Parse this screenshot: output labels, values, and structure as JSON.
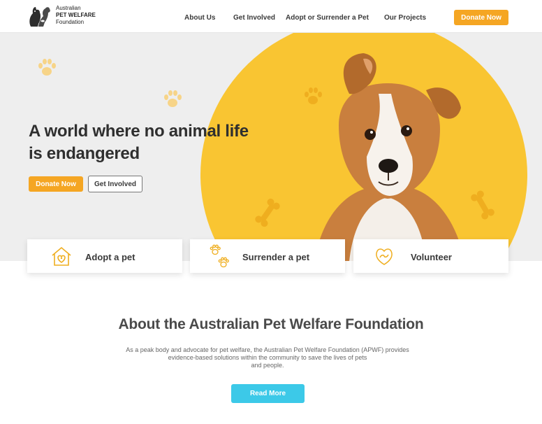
{
  "logo": {
    "line1": "Australian",
    "line2": "PET WELFARE",
    "line3": "Foundation"
  },
  "nav": {
    "items": [
      {
        "label": "About Us"
      },
      {
        "label": "Get Involved"
      },
      {
        "label": "Adopt or Surrender a Pet"
      },
      {
        "label": "Our Projects"
      }
    ],
    "donate_label": "Donate Now"
  },
  "hero": {
    "title": "A world where no animal life is endangered",
    "donate_label": "Donate Now",
    "involved_label": "Get Involved"
  },
  "cards": [
    {
      "label": "Adopt a pet",
      "icon": "heart-house-icon"
    },
    {
      "label": "Surrender a pet",
      "icon": "paw-prints-icon"
    },
    {
      "label": "Volunteer",
      "icon": "hands-heart-icon"
    }
  ],
  "about": {
    "title": "About the Australian Pet Welfare Foundation",
    "text_line1": "As a peak body and advocate for pet welfare, the Australian Pet Welfare Foundation (APWF) provides",
    "text_line2": "evidence-based solutions within the community to save the lives of pets",
    "text_line3": "and people.",
    "read_more_label": "Read More"
  },
  "colors": {
    "accent_orange": "#f5a623",
    "hero_yellow": "#f9c532",
    "hero_bg": "#eeeeee",
    "read_more_blue": "#3cc9e8"
  }
}
